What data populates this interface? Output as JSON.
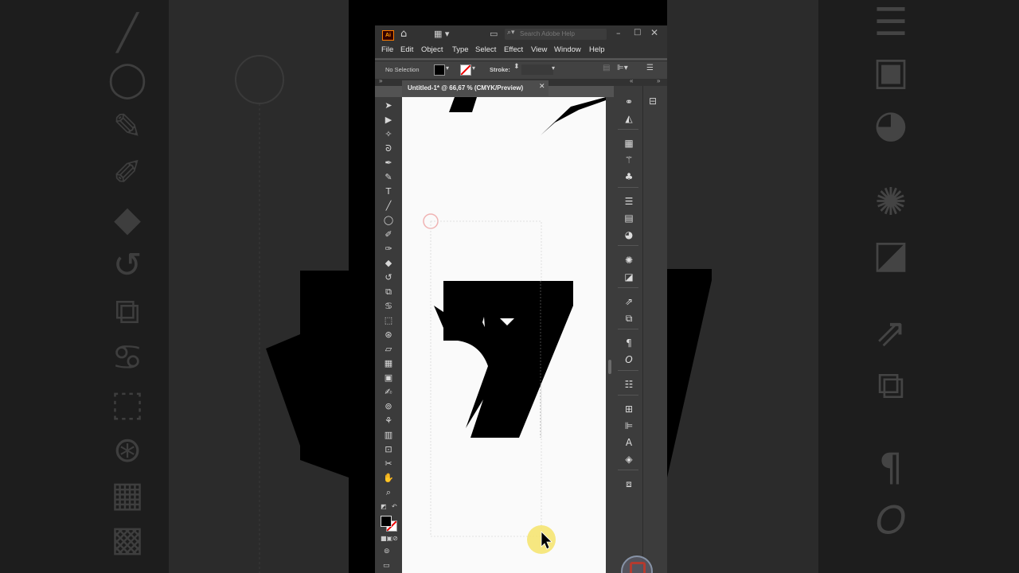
{
  "app": {
    "logo": "Ai",
    "search_placeholder": "Search Adobe Help",
    "window_controls": [
      "minimize-icon",
      "maximize-icon",
      "close-icon"
    ]
  },
  "menu": [
    "File",
    "Edit",
    "Object",
    "Type",
    "Select",
    "Effect",
    "View",
    "Window",
    "Help"
  ],
  "control": {
    "selection": "No Selection",
    "stroke_label": "Stroke:"
  },
  "document": {
    "tab_title": "Untitled-1* @ 66,67 % (CMYK/Preview)"
  },
  "tools": [
    "selection-tool-icon",
    "direct-selection-tool-icon",
    "magic-wand-tool-icon",
    "lasso-tool-icon",
    "pen-tool-icon",
    "curvature-tool-icon",
    "type-tool-icon",
    "line-segment-tool-icon",
    "ellipse-tool-icon",
    "paintbrush-tool-icon",
    "shaper-tool-icon",
    "eraser-tool-icon",
    "rotate-tool-icon",
    "scale-tool-icon",
    "warp-tool-icon",
    "free-transform-tool-icon",
    "shape-builder-tool-icon",
    "perspective-grid-tool-icon",
    "mesh-tool-icon",
    "gradient-tool-icon",
    "eyedropper-tool-icon",
    "blend-tool-icon",
    "symbol-sprayer-tool-icon",
    "column-graph-tool-icon",
    "artboard-tool-icon",
    "slice-tool-icon",
    "hand-tool-icon",
    "zoom-tool-icon"
  ],
  "dock_panels": [
    "color-guide-icon",
    "color-icon",
    "swatches-icon",
    "brushes-icon",
    "symbols-icon",
    "stroke-icon",
    "gradient-icon",
    "transparency-icon",
    "appearance-icon",
    "graphic-styles-icon",
    "export-icon",
    "artboards-icon",
    "paragraph-icon",
    "opentype-icon",
    "properties-icon",
    "align-icon",
    "align-objects-icon",
    "character-icon",
    "layers-icon",
    "links-icon"
  ],
  "colors": {
    "fill": "#000000",
    "stroke": "none",
    "ui_dark": "#323232",
    "ui_panel": "#535353",
    "artboard": "#fafafa",
    "cursor_highlight": "#f5e36a"
  }
}
